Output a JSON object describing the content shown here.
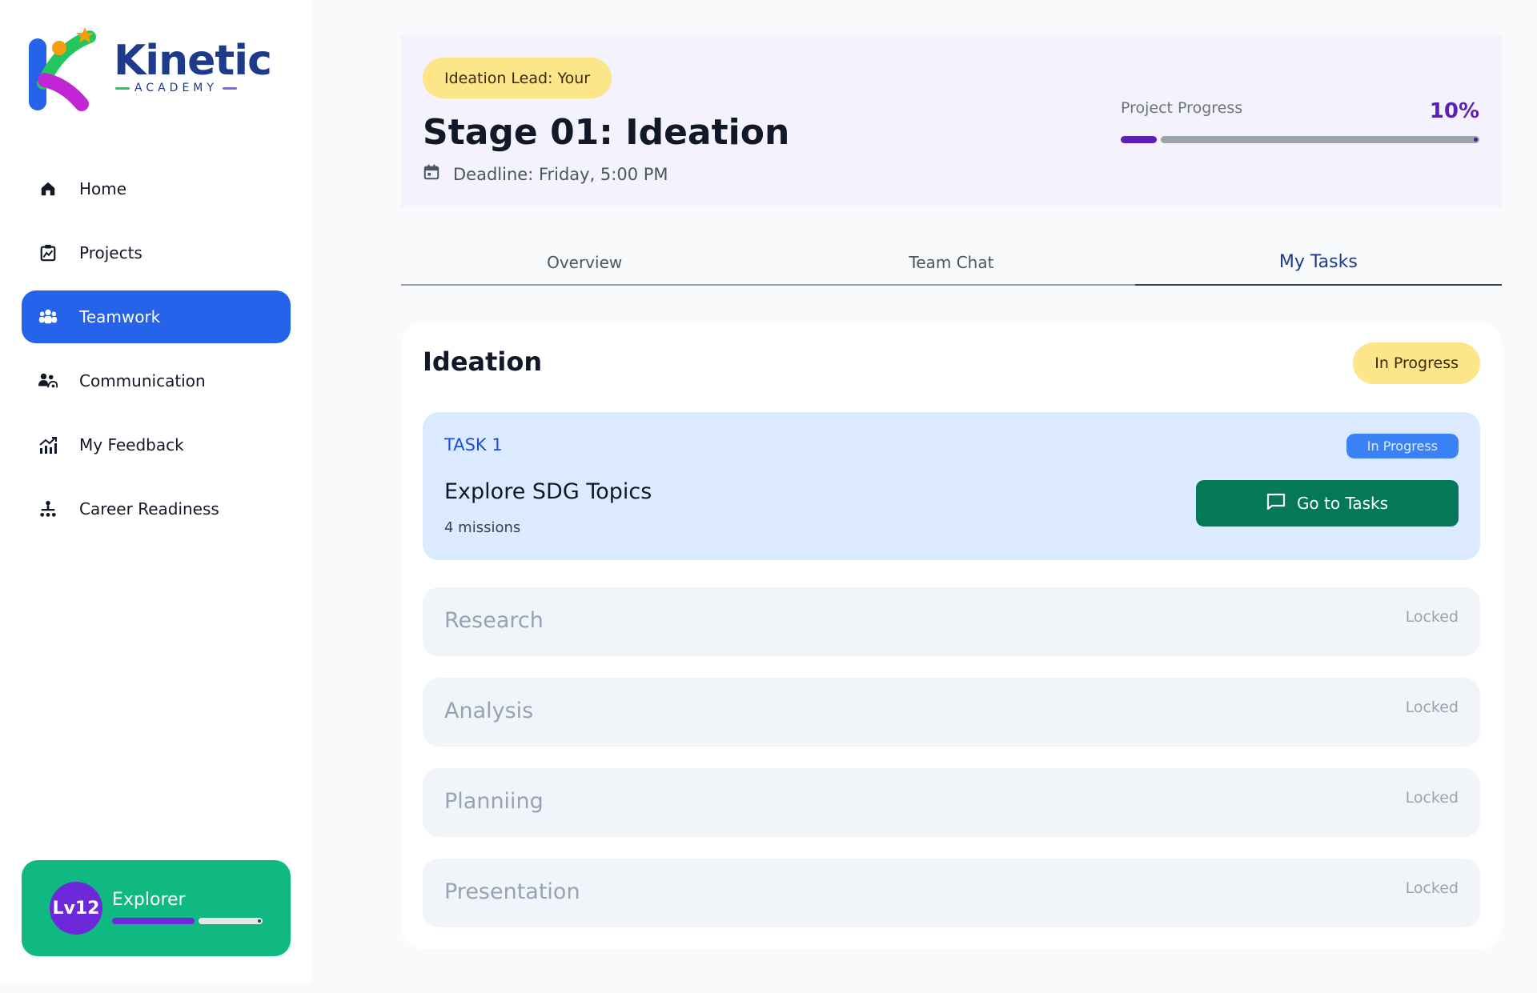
{
  "brand": {
    "name": "Kinetic",
    "tagline": "ACADEMY"
  },
  "sidebar": {
    "items": [
      {
        "label": "Home",
        "icon": "home-icon"
      },
      {
        "label": "Projects",
        "icon": "projects-icon"
      },
      {
        "label": "Teamwork",
        "icon": "teamwork-icon",
        "active": true
      },
      {
        "label": "Communication",
        "icon": "communication-icon"
      },
      {
        "label": "My Feedback",
        "icon": "chart-icon"
      },
      {
        "label": "Career Readiness",
        "icon": "hierarchy-icon"
      }
    ],
    "level": {
      "badge": "Lv12",
      "title": "Explorer",
      "progress_fraction": 0.55
    }
  },
  "header": {
    "lead": "Ideation Lead: Your",
    "stage_title": "Stage 01: Ideation",
    "deadline": "Deadline: Friday, 5:00 PM",
    "progress_label": "Project Progress",
    "progress_value": "10%",
    "progress_fraction": 0.1
  },
  "tabs": [
    {
      "label": "Overview"
    },
    {
      "label": "Team Chat"
    },
    {
      "label": "My Tasks",
      "active": true
    }
  ],
  "panel": {
    "title": "Ideation",
    "status": "In Progress",
    "task": {
      "label": "TASK 1",
      "badge": "In Progress",
      "title": "Explore SDG Topics",
      "subtitle": "4 missions",
      "button": "Go to Tasks"
    },
    "locked_stages": [
      {
        "name": "Research",
        "state": "Locked"
      },
      {
        "name": "Analysis",
        "state": "Locked"
      },
      {
        "name": "Planniing",
        "state": "Locked"
      },
      {
        "name": "Presentation",
        "state": "Locked"
      }
    ]
  },
  "colors": {
    "primary": "#2563eb",
    "accent_purple": "#5b21b6",
    "success": "#10b981",
    "button_green": "#047857",
    "pill_yellow": "#fde68a"
  }
}
